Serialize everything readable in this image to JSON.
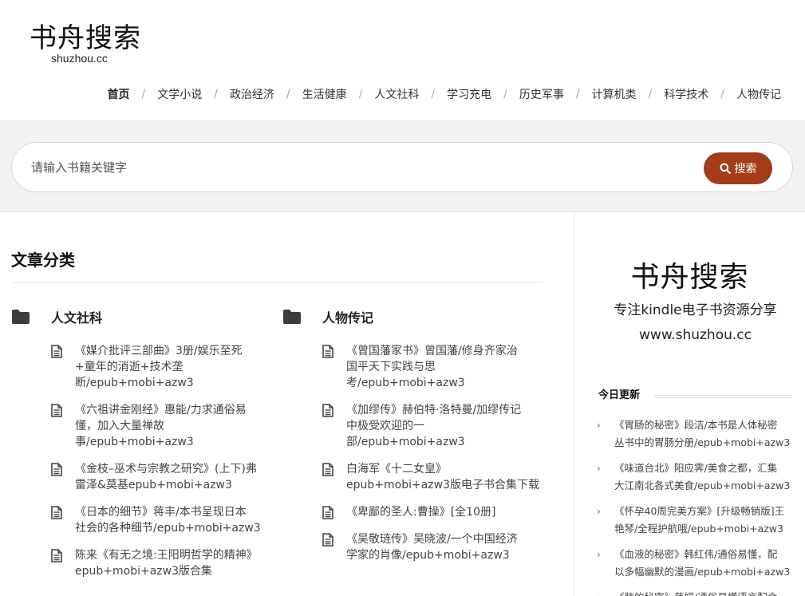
{
  "header": {
    "logo_title": "书舟搜索",
    "logo_sub": "shuzhou.cc",
    "nav": [
      "首页",
      "文学小说",
      "政治经济",
      "生活健康",
      "人文社科",
      "学习充电",
      "历史军事",
      "计算机类",
      "科学技术",
      "人物传记"
    ],
    "nav_active": "首页"
  },
  "search": {
    "placeholder": "请输入书籍关键字",
    "button_label": "搜索",
    "button_color": "#a43c1a"
  },
  "main": {
    "section_title": "文章分类",
    "categories": [
      {
        "name": "人文社科",
        "posts": [
          "《媒介批评三部曲》3册/娱乐至死+童年的消逝+技术垄断/epub+mobi+azw3",
          "《六祖讲金刚经》惠能/力求通俗易懂，加入大量禅故事/epub+mobi+azw3",
          "《金枝–巫术与宗教之研究》(上下)弗雷泽&莫基epub+mobi+azw3",
          "《日本的细节》蒋丰/本书呈现日本社会的各种细节/epub+mobi+azw3",
          "陈来《有无之境:王阳明哲学的精神》epub+mobi+azw3版合集"
        ]
      },
      {
        "name": "人物传记",
        "posts": [
          "《曾国藩家书》曾国藩/修身齐家治国平天下实践与思考/epub+mobi+azw3",
          "《加缪传》赫伯特·洛特曼/加缪传记中极受欢迎的一部/epub+mobi+azw3",
          "白海军《十二女皇》epub+mobi+azw3版电子书合集下载",
          "《卑鄙的圣人:曹操》[全10册]",
          "《吴敬琏传》吴晓波/一个中国经济学家的肖像/epub+mobi+azw3"
        ]
      }
    ]
  },
  "sidebar": {
    "title": "书舟搜索",
    "tagline": "专注kindle电子书资源分享",
    "url": "www.shuzhou.cc",
    "today_title": "今日更新",
    "today_items": [
      "《胃肠的秘密》段洁/本书是人体秘密丛书中的胃肠分册/epub+mobi+azw3",
      "《味道台北》阳应霁/美食之都，汇集大江南北各式美食/epub+mobi+azw3",
      "《怀孕40周完美方案》[升级畅销版]王艳琴/全程护航哦/epub+mobi+azw3",
      "《血液的秘密》韩红伟/通俗易懂，配以多幅幽默的漫画/epub+mobi+azw3",
      "《肺的秘密》范娟/通俗易懂语言配合"
    ]
  }
}
